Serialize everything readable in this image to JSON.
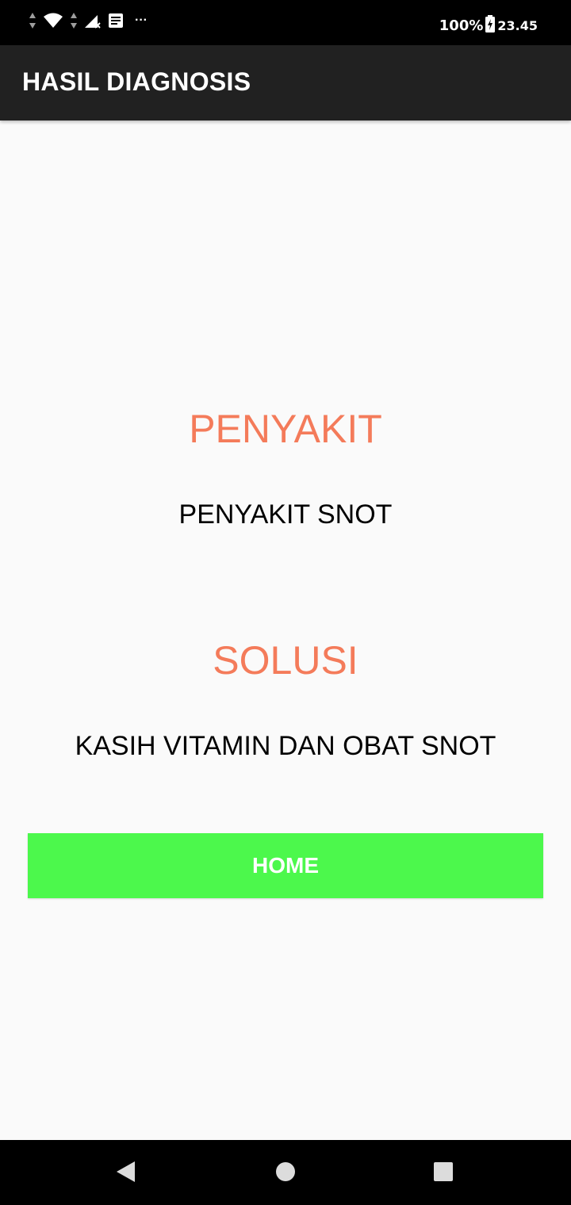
{
  "status_bar": {
    "battery": "100%",
    "time": "23.45",
    "more": "···",
    "icons": [
      "data-arrows-icon",
      "wifi-icon",
      "signal-no-sim-icon",
      "notification-icon",
      "more-icon",
      "battery-charging-icon"
    ]
  },
  "app_bar": {
    "title": "HASIL DIAGNOSIS"
  },
  "main": {
    "disease_heading": "PENYAKIT",
    "disease_value": "PENYAKIT SNOT",
    "solution_heading": "SOLUSI",
    "solution_value": "KASIH VITAMIN DAN OBAT SNOT",
    "home_button": "HOME"
  },
  "nav_bar": {
    "icons": [
      "back-icon",
      "home-circle-icon",
      "recents-icon"
    ]
  },
  "colors": {
    "status_bar": "#000000",
    "app_bar": "#212121",
    "heading": "#f47b5a",
    "button": "#4cf84c",
    "background": "#fafafa"
  }
}
